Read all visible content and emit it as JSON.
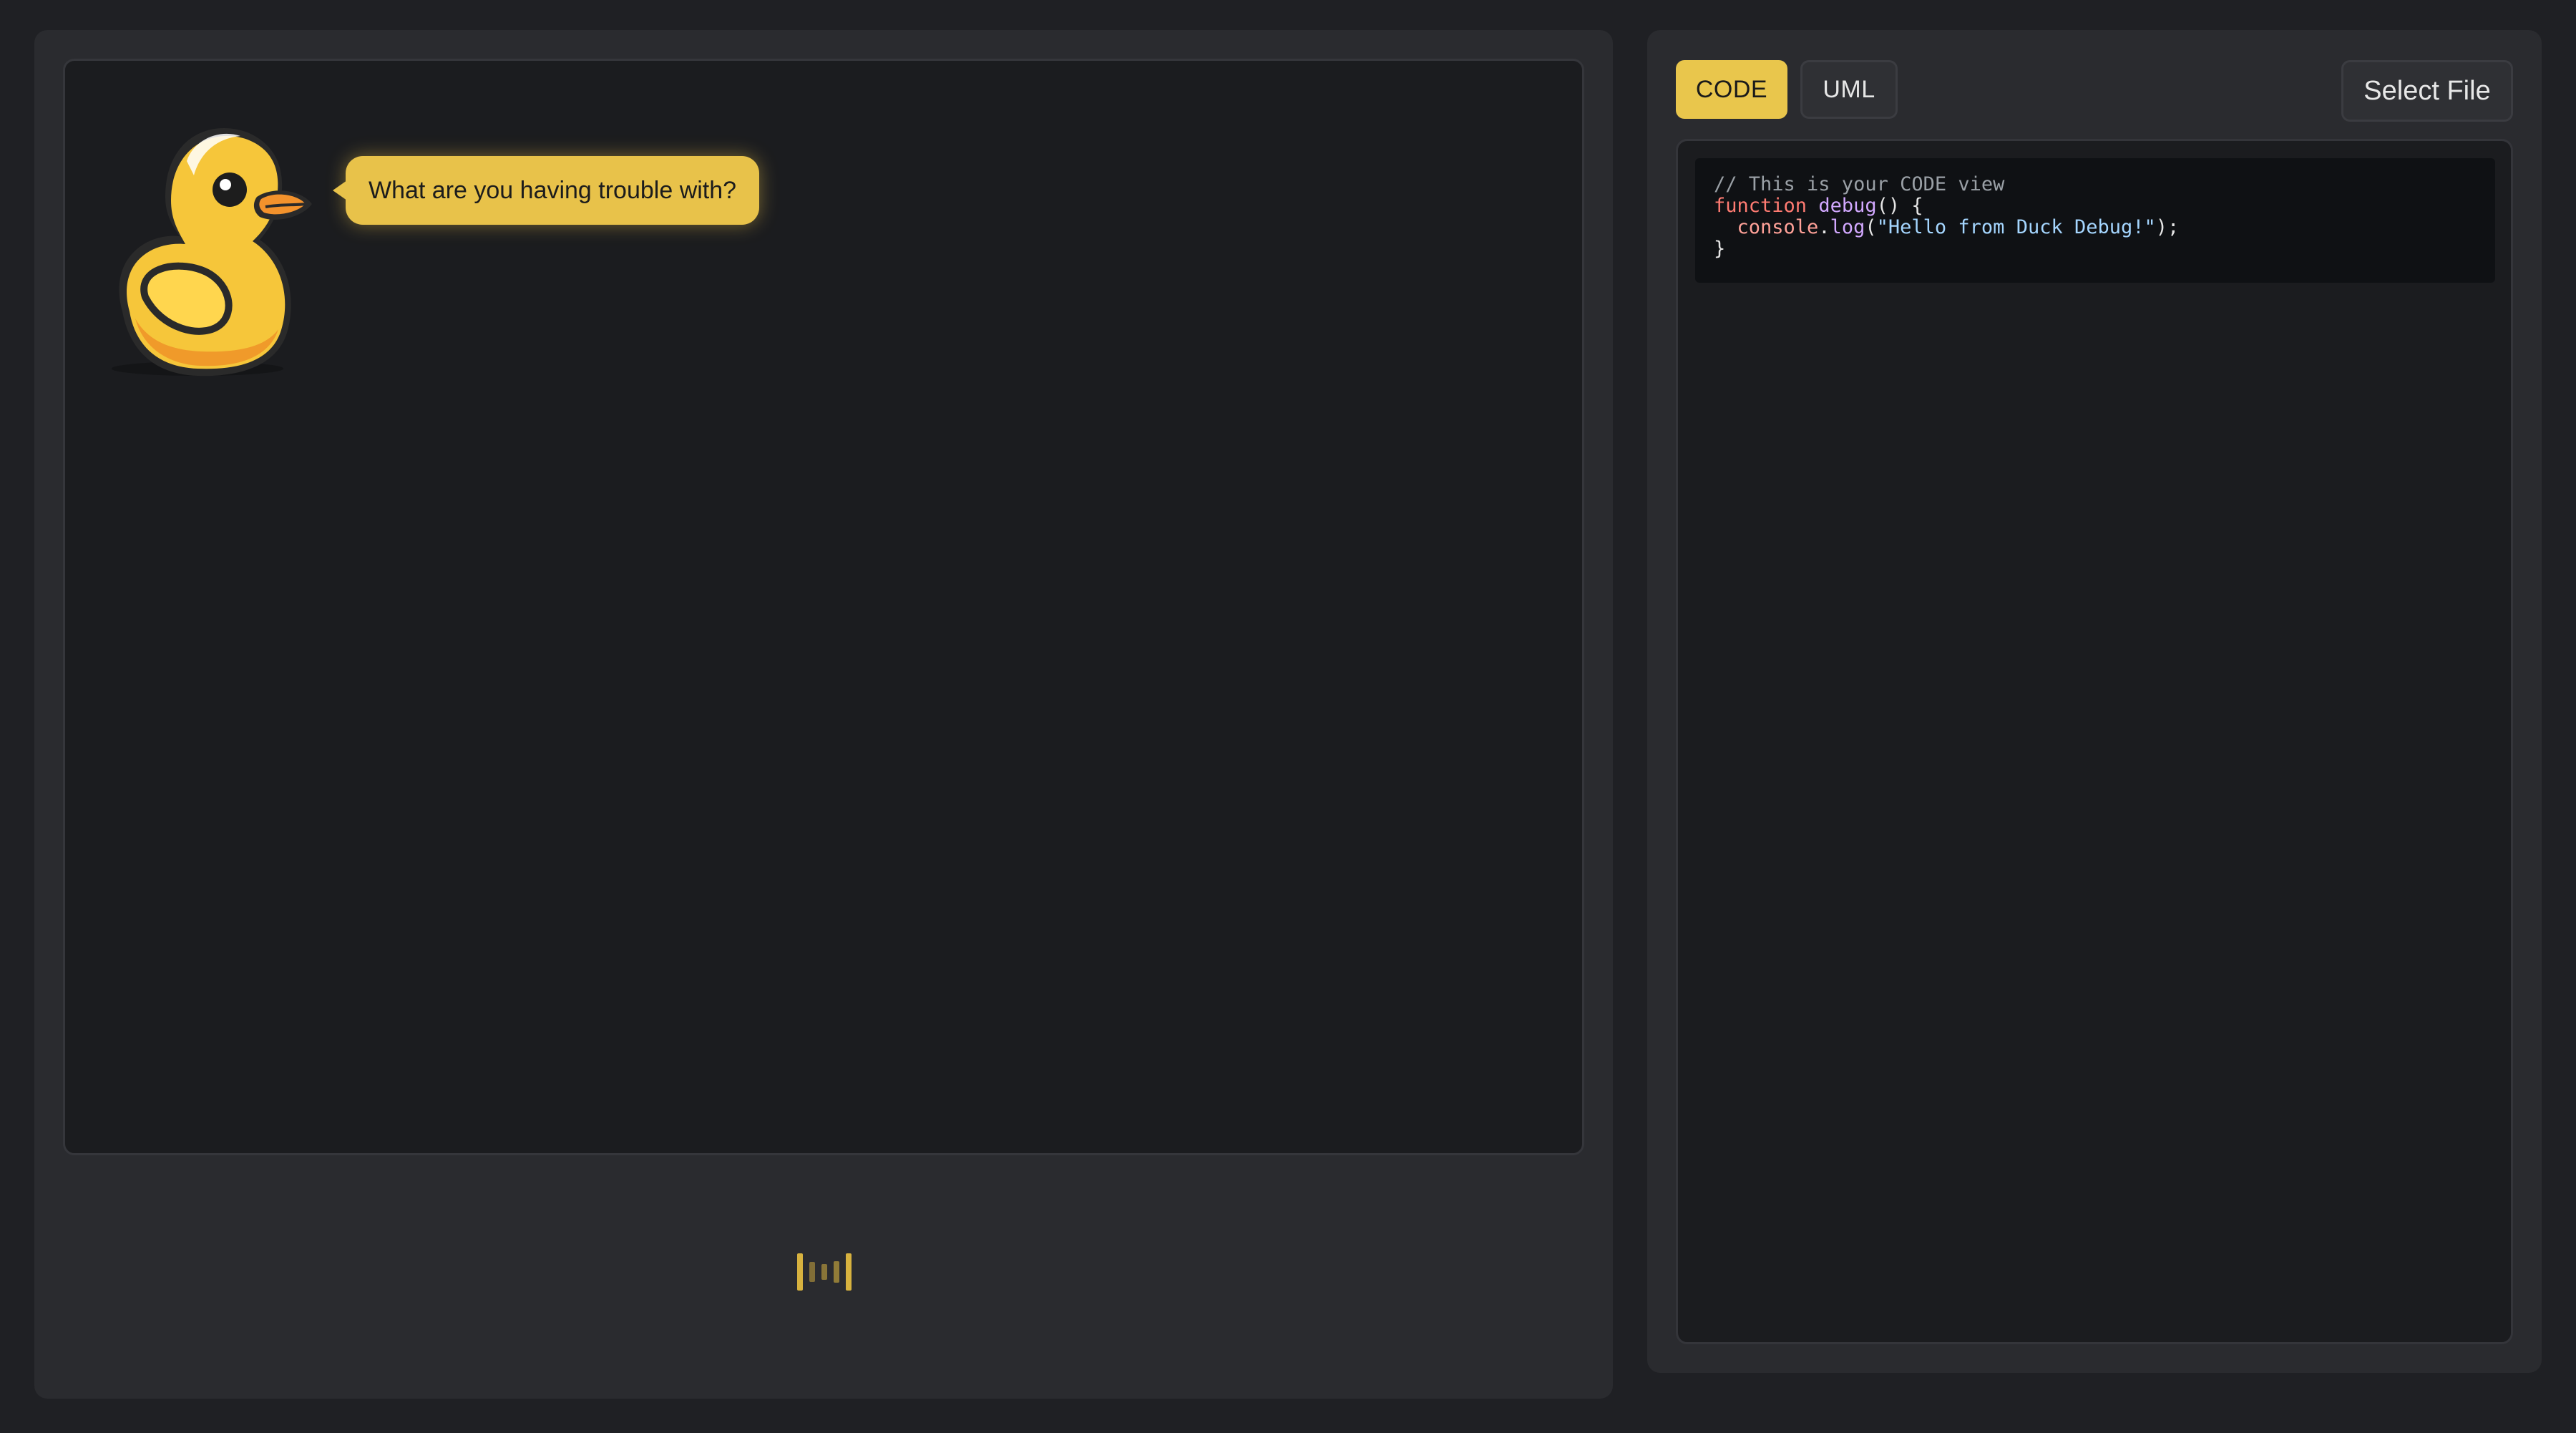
{
  "chat": {
    "prompt": "What are you having trouble with?"
  },
  "tabs": [
    {
      "label": "CODE",
      "active": true
    },
    {
      "label": "UML",
      "active": false
    }
  ],
  "toolbar": {
    "select_file_label": "Select File"
  },
  "code_view": {
    "line1_comment": "// This is your CODE view",
    "line2_kw": "function",
    "line2_fn": "debug",
    "line2_rest": "() {",
    "line3_indent": "  ",
    "line3_obj": "console",
    "line3_dot": ".",
    "line3_method": "log",
    "line3_open": "(",
    "line3_str": "\"Hello from Duck Debug!\"",
    "line3_close": ");",
    "line4": "}"
  },
  "colors": {
    "accent": "#e9c64c",
    "background": "#1f2024",
    "panel": "#2a2b2f"
  },
  "icons": {
    "mascot": "rubber-duck-icon",
    "mic": "voice-wave-icon"
  }
}
